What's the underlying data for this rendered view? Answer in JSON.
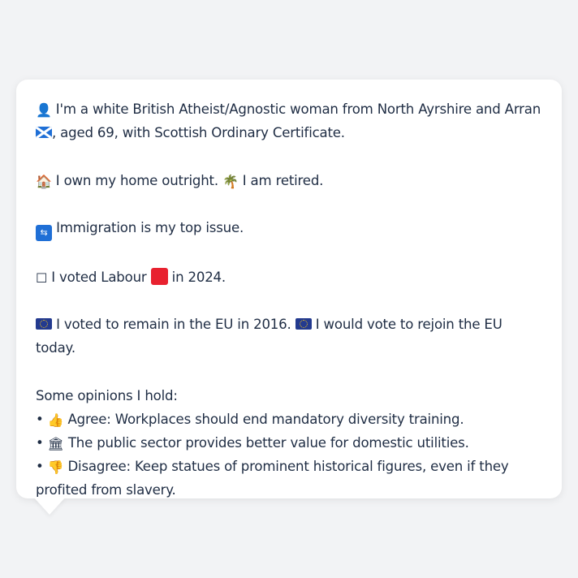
{
  "profile": {
    "intro_icon": "person-silhouette-icon",
    "intro_part1": " I'm a white British Atheist/Agnostic woman from North Ayrshire and Arran ",
    "intro_flag": "scotland-flag-icon",
    "intro_part2": ", aged 69, with Scottish Ordinary Certificate.",
    "home_icon": "house-icon",
    "home_text": " I own my home outright. ",
    "retired_icon": "palm-tree-icon",
    "retired_text": " I am retired.",
    "issue_icon": "immigration-icon",
    "issue_text": " Immigration is my top issue.",
    "vote_icon": "ballot-box-icon",
    "vote_part1": " I voted Labour ",
    "vote_party_icon": "red-square-icon",
    "vote_part2": " in 2024.",
    "eu_icon": "eu-flag-icon",
    "eu_part1": " I voted to remain in the EU in 2016. ",
    "eu_part2": " I would vote to rejoin the EU today.",
    "opinions_heading": "Some opinions I hold:",
    "opinions": [
      {
        "bullet": "•",
        "icon": "thumbs-up-icon",
        "text": " Agree: Workplaces should end mandatory diversity training."
      },
      {
        "bullet": "•",
        "icon": "classical-building-icon",
        "text": " The public sector provides better value for domestic utilities."
      },
      {
        "bullet": "•",
        "icon": "thumbs-down-icon",
        "text": " Disagree: Keep statues of prominent historical figures, even if they profited from slavery."
      }
    ]
  },
  "colors": {
    "background": "#f2f3f5",
    "card": "#ffffff",
    "text": "#1f2d44",
    "labour_red": "#e8212f",
    "eu_blue": "#233a8f"
  }
}
